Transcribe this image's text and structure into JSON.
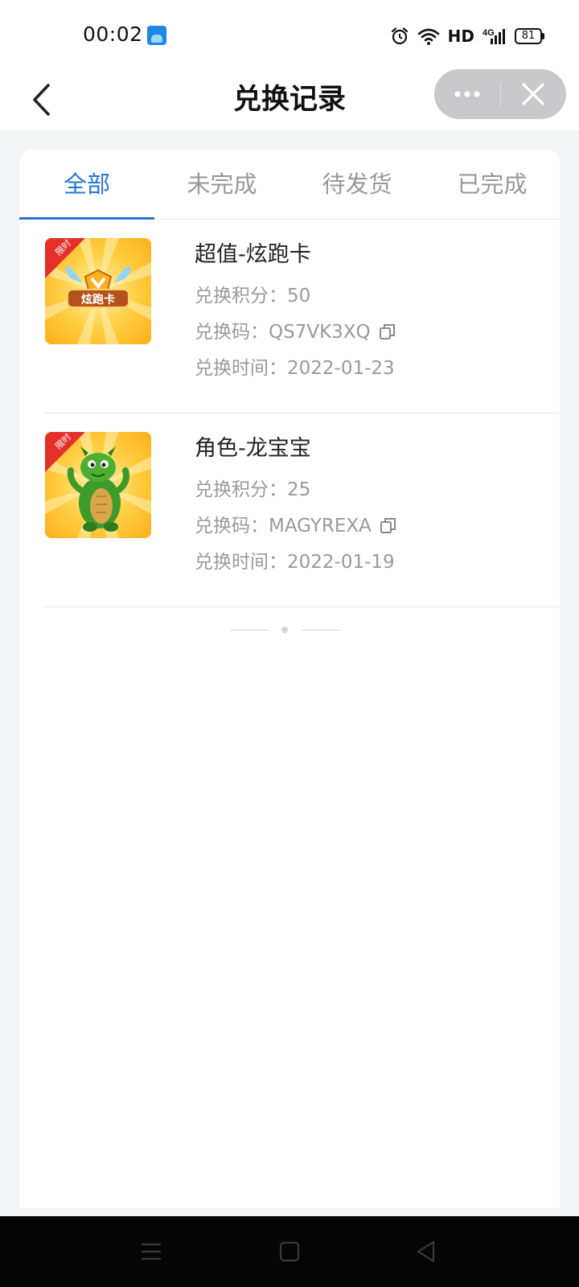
{
  "status_bar": {
    "time": "00:02",
    "hd": "HD",
    "network": "4G",
    "battery": "81"
  },
  "nav": {
    "title": "兑换记录"
  },
  "tabs": [
    {
      "label": "全部",
      "active": true
    },
    {
      "label": "未完成",
      "active": false
    },
    {
      "label": "待发货",
      "active": false
    },
    {
      "label": "已完成",
      "active": false
    }
  ],
  "records": [
    {
      "badge": "限时",
      "thumb_text": "炫跑卡",
      "name": "超值-炫跑卡",
      "points": "兑换积分：50",
      "code": "兑换码：QS7VK3XQ",
      "time": "兑换时间：2022-01-23"
    },
    {
      "badge": "限时",
      "name": "角色-龙宝宝",
      "points": "兑换积分：25",
      "code": "兑换码：MAGYREXA",
      "time": "兑换时间：2022-01-19"
    }
  ],
  "colors": {
    "accent": "#2674d6",
    "muted_text": "#9a9a9a",
    "page_bg": "#f3f4f6",
    "badge_red": "#e5302a",
    "thumb_yellow": "#ffc23a"
  },
  "icons": {
    "back": "chevron-left-icon",
    "more": "more-dots-icon",
    "close": "close-icon",
    "copy": "copy-icon",
    "alarm": "alarm-icon",
    "wifi": "wifi-icon",
    "signal": "signal-icon"
  }
}
